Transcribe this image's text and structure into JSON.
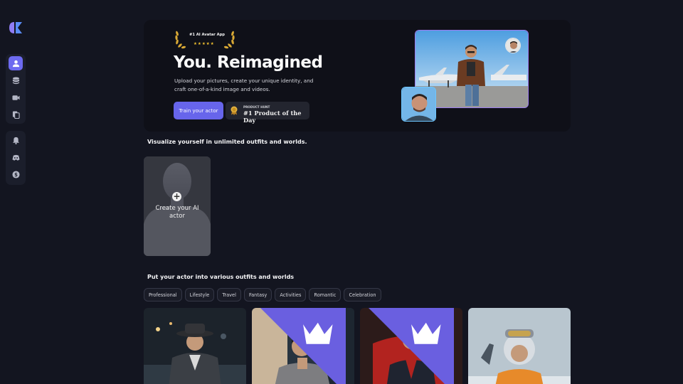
{
  "app": {
    "name": "AI Avatar App"
  },
  "sidebar": {
    "group1": [
      {
        "icon": "user-icon",
        "active": true
      },
      {
        "icon": "database-icon",
        "active": false
      },
      {
        "icon": "video-icon",
        "active": false
      },
      {
        "icon": "copy-icon",
        "active": false
      }
    ],
    "group2": [
      {
        "icon": "bell-icon"
      },
      {
        "icon": "discord-icon"
      },
      {
        "icon": "dollar-icon"
      }
    ]
  },
  "hero": {
    "award_label": "#1 AI Avatar App",
    "stars": "★★★★★",
    "title": "You. Reimagined",
    "subtitle": "Upload your pictures, create your unique identity, and craft one-of-a-kind image and videos.",
    "cta_label": "Train your actor",
    "product_hunt_eyebrow": "PRODUCT HUNT",
    "product_hunt_text": "#1 Product of the Day"
  },
  "section1": {
    "title": "Visualize yourself in unlimited outfits and worlds.",
    "create_card_label": "Create your AI actor"
  },
  "section2": {
    "title": "Put your actor into various outfits and worlds",
    "categories": [
      "Professional",
      "Lifestyle",
      "Travel",
      "Fantasy",
      "Activities",
      "Romantic",
      "Celebration"
    ]
  },
  "colors": {
    "accent": "#6765eb",
    "background": "#131520",
    "gold": "#f2c230"
  }
}
